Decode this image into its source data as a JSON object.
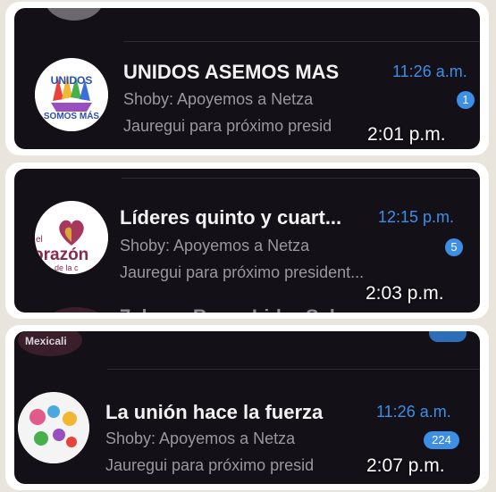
{
  "cards": [
    {
      "title": "UNIDOS ASEMOS MAS",
      "time": "11:26 a.m.",
      "sender_line": "Shoby: Apoyemos a Netza",
      "preview_line": "Jauregui para próximo presid",
      "badge": "1",
      "stamp": "2:01 p.m.",
      "avatar_text_top": "UNIDOS",
      "avatar_text_bottom": "SOMOS MÁS"
    },
    {
      "title": "Líderes quinto y cuart...",
      "time": "12:15 p.m.",
      "sender_line": "Shoby: Apoyemos a Netza",
      "preview_line": "Jauregui para próximo president...",
      "badge": "5",
      "stamp": "2:03 p.m.",
      "avatar_text_left": "el",
      "avatar_text_main": "orazón",
      "avatar_text_sub": "de la c",
      "next_row_partial": "7alamo Borro Lider Sal"
    },
    {
      "above_label": "Mexicali",
      "title": "La unión hace la fuerza",
      "time": "11:26 a.m.",
      "sender_line": "Shoby: Apoyemos a Netza",
      "preview_line": "Jauregui para próximo presid",
      "badge": "224",
      "stamp": "2:07 p.m."
    }
  ],
  "colors": {
    "accent": "#3d8fe6",
    "panel": "#141018",
    "card": "#ffffff",
    "background": "#e9e4dc"
  }
}
